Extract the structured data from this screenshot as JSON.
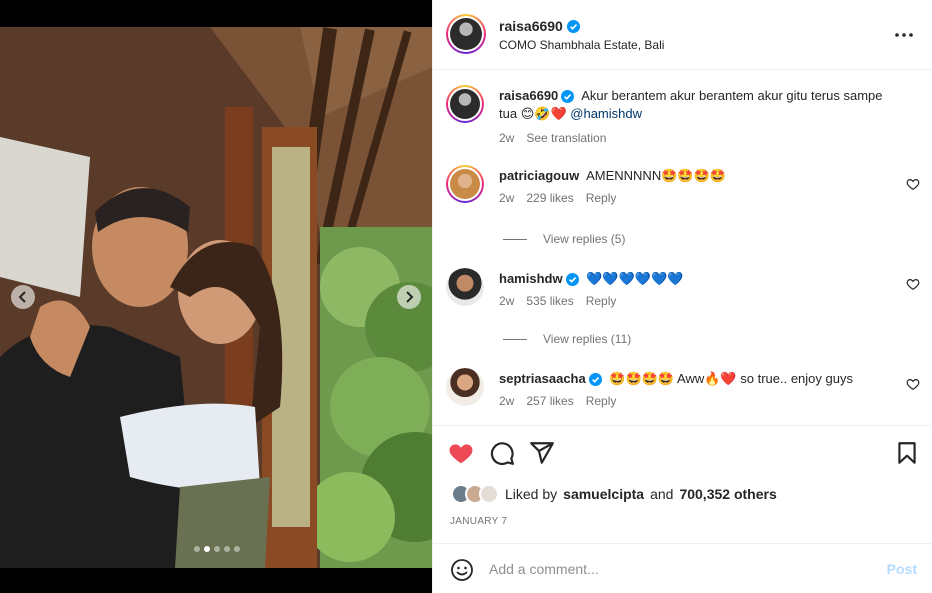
{
  "post": {
    "username": "raisa6690",
    "location": "COMO Shambhala Estate, Bali",
    "caption_text": "Akur berantem akur berantem akur gitu terus sampe tua",
    "caption_emojis": "😊🤣❤️",
    "caption_mention": "@hamishdw",
    "caption_time": "2w",
    "see_translation": "See translation",
    "likes_prefix": "Liked by",
    "likes_user": "samuelcipta",
    "likes_and": "and",
    "likes_count": "700,352 others",
    "date": "JANUARY 7",
    "carousel": {
      "total": 5,
      "active": 1
    }
  },
  "comments": [
    {
      "username": "patriciagouw",
      "verified": false,
      "text": "AMENNNNN",
      "emojis": "🤩🤩🤩🤩",
      "time": "2w",
      "likes": "229 likes",
      "reply": "Reply",
      "view_replies": "View replies (5)"
    },
    {
      "username": "hamishdw",
      "verified": true,
      "text": "",
      "emojis": "💙💙💙💙💙💙",
      "time": "2w",
      "likes": "535 likes",
      "reply": "Reply",
      "view_replies": "View replies (11)"
    },
    {
      "username": "septriasaacha",
      "verified": true,
      "text_before": "",
      "emojis_before": "🤩🤩🤩🤩",
      "text_mid": "Aww",
      "emojis_mid": "🔥❤️",
      "text_after": "so true.. enjoy guys",
      "time": "2w",
      "likes": "257 likes",
      "reply": "Reply"
    }
  ],
  "composer": {
    "placeholder": "Add a comment...",
    "post_label": "Post"
  },
  "colors": {
    "like_red": "#ed4956",
    "link_blue": "#00376b",
    "post_disabled": "#b3dbff",
    "verified_blue": "#0095f6"
  },
  "icons": {
    "like": "heart-filled-icon",
    "comment": "comment-bubble-icon",
    "share": "paper-plane-icon",
    "save": "bookmark-icon",
    "more": "more-horizontal-icon",
    "emoji": "smiley-icon"
  }
}
